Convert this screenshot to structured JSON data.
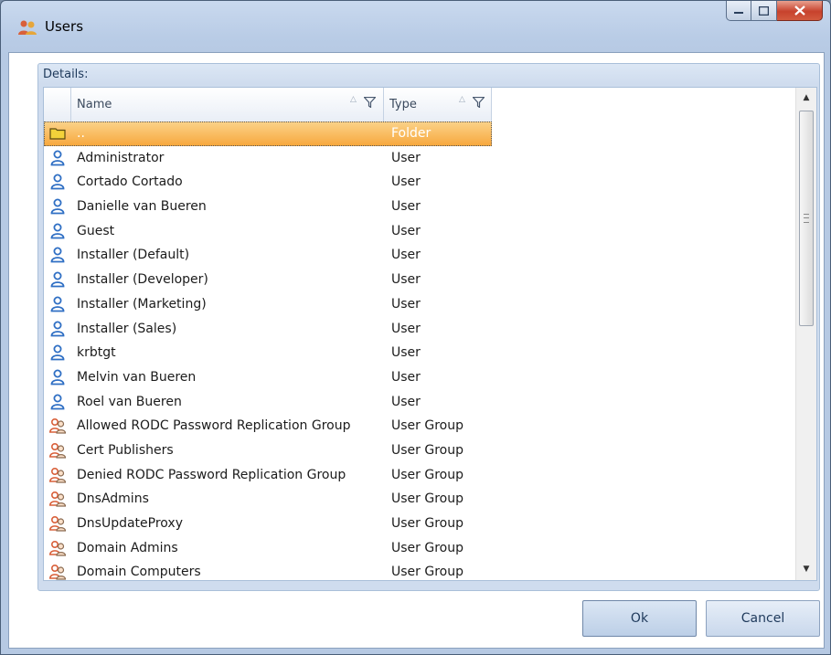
{
  "window": {
    "title": "Users",
    "title_icon": "users-icon"
  },
  "caption_buttons": {
    "minimize_icon": "minimize-icon",
    "maximize_icon": "maximize-icon",
    "close_icon": "close-icon"
  },
  "details": {
    "label": "Details:",
    "columns": [
      {
        "label": "Name",
        "sort_icon": "sort-indicator-icon",
        "filter_icon": "filter-icon"
      },
      {
        "label": "Type",
        "sort_icon": "sort-indicator-icon",
        "filter_icon": "filter-icon"
      }
    ],
    "rows": [
      {
        "icon": "folder-icon",
        "name": "..",
        "type": "Folder",
        "selected": true
      },
      {
        "icon": "user-icon",
        "name": "Administrator",
        "type": "User"
      },
      {
        "icon": "user-icon",
        "name": "Cortado Cortado",
        "type": "User"
      },
      {
        "icon": "user-icon",
        "name": "Danielle van Bueren",
        "type": "User"
      },
      {
        "icon": "user-icon",
        "name": "Guest",
        "type": "User"
      },
      {
        "icon": "user-icon",
        "name": "Installer (Default)",
        "type": "User"
      },
      {
        "icon": "user-icon",
        "name": "Installer (Developer)",
        "type": "User"
      },
      {
        "icon": "user-icon",
        "name": "Installer (Marketing)",
        "type": "User"
      },
      {
        "icon": "user-icon",
        "name": "Installer (Sales)",
        "type": "User"
      },
      {
        "icon": "user-icon",
        "name": "krbtgt",
        "type": "User"
      },
      {
        "icon": "user-icon",
        "name": "Melvin van Bueren",
        "type": "User"
      },
      {
        "icon": "user-icon",
        "name": "Roel van Bueren",
        "type": "User"
      },
      {
        "icon": "user-group-icon",
        "name": "Allowed RODC Password Replication Group",
        "type": "User Group"
      },
      {
        "icon": "user-group-icon",
        "name": "Cert Publishers",
        "type": "User Group"
      },
      {
        "icon": "user-group-icon",
        "name": "Denied RODC Password Replication Group",
        "type": "User Group"
      },
      {
        "icon": "user-group-icon",
        "name": "DnsAdmins",
        "type": "User Group"
      },
      {
        "icon": "user-group-icon",
        "name": "DnsUpdateProxy",
        "type": "User Group"
      },
      {
        "icon": "user-group-icon",
        "name": "Domain Admins",
        "type": "User Group"
      },
      {
        "icon": "user-group-icon",
        "name": "Domain Computers",
        "type": "User Group"
      }
    ]
  },
  "buttons": {
    "ok": "Ok",
    "cancel": "Cancel"
  },
  "colors": {
    "selection": "#f7a73c",
    "user_icon": "#2f6fc4",
    "group_icon": "#d9603a",
    "folder_icon": "#f3d23a"
  }
}
